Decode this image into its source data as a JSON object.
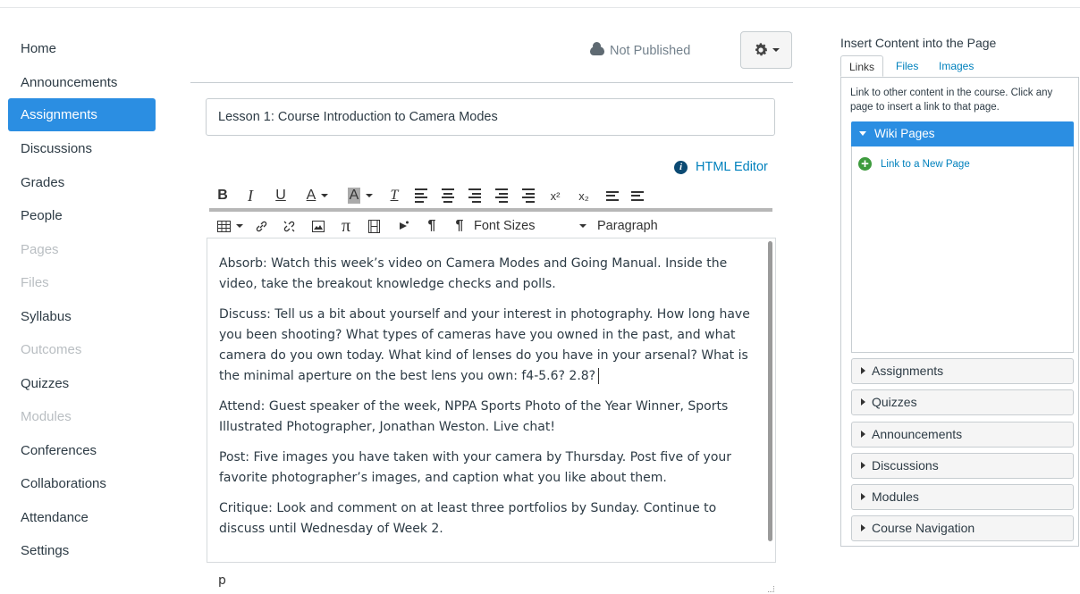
{
  "nav": {
    "items": [
      {
        "label": "Home",
        "state": "normal"
      },
      {
        "label": "Announcements",
        "state": "normal"
      },
      {
        "label": "Assignments",
        "state": "active"
      },
      {
        "label": "Discussions",
        "state": "normal"
      },
      {
        "label": "Grades",
        "state": "normal"
      },
      {
        "label": "People",
        "state": "normal"
      },
      {
        "label": "Pages",
        "state": "disabled"
      },
      {
        "label": "Files",
        "state": "disabled"
      },
      {
        "label": "Syllabus",
        "state": "normal"
      },
      {
        "label": "Outcomes",
        "state": "disabled"
      },
      {
        "label": "Quizzes",
        "state": "normal"
      },
      {
        "label": "Modules",
        "state": "disabled"
      },
      {
        "label": "Conferences",
        "state": "normal"
      },
      {
        "label": "Collaborations",
        "state": "normal"
      },
      {
        "label": "Attendance",
        "state": "normal"
      },
      {
        "label": "Settings",
        "state": "normal"
      }
    ]
  },
  "header": {
    "status_label": "Not Published",
    "status_icon": "cloud-icon",
    "settings_icon": "gear-icon"
  },
  "editor": {
    "title_value": "Lesson 1: Course Introduction to Camera Modes",
    "html_editor_label": "HTML Editor",
    "toolbar1": {
      "bold": "B",
      "italic": "I",
      "underline": "U",
      "text_color": "A",
      "background_color": "A",
      "clear_format": "T",
      "superscript": "x²",
      "subscript": "x₂"
    },
    "toolbar2": {
      "math": "π",
      "ltr": "¶",
      "rtl": "¶",
      "font_sizes": "Font Sizes",
      "paragraph": "Paragraph"
    },
    "paragraphs": [
      "Absorb: Watch this week’s video on Camera Modes and Going Manual. Inside the video, take the breakout knowledge checks and polls.",
      "Discuss: Tell us a bit about yourself and your interest in photography. How long have you been shooting? What types of cameras have you owned in the past, and what camera do you own today. What kind of lenses do you have in your arsenal? What is the minimal aperture on the best lens you own: f4-5.6? 2.8?",
      "Attend: Guest speaker of the week, NPPA Sports Photo of the Year Winner, Sports Illustrated Photographer, Jonathan Weston. Live chat!",
      "Post: Five images you have taken with your camera by Thursday. Post five of your favorite photographer’s images, and caption what you like about them.",
      "Critique: Look and comment on at least three portfolios by Sunday. Continue to discuss until Wednesday of Week 2."
    ],
    "path": "p"
  },
  "sidebar": {
    "title": "Insert Content into the Page",
    "tabs": [
      "Links",
      "Files",
      "Images"
    ],
    "active_tab": "Links",
    "description": "Link to other content in the course. Click any page to insert a link to that page.",
    "open_section": "Wiki Pages",
    "new_page_link": "Link to a New Page",
    "sections": [
      "Assignments",
      "Quizzes",
      "Announcements",
      "Discussions",
      "Modules",
      "Course Navigation"
    ]
  },
  "colors": {
    "accent": "#2b8ee2",
    "link": "#0081bd",
    "text": "#2d3b45",
    "disabled": "#b9bec2",
    "add_icon": "#3e9b3e"
  }
}
